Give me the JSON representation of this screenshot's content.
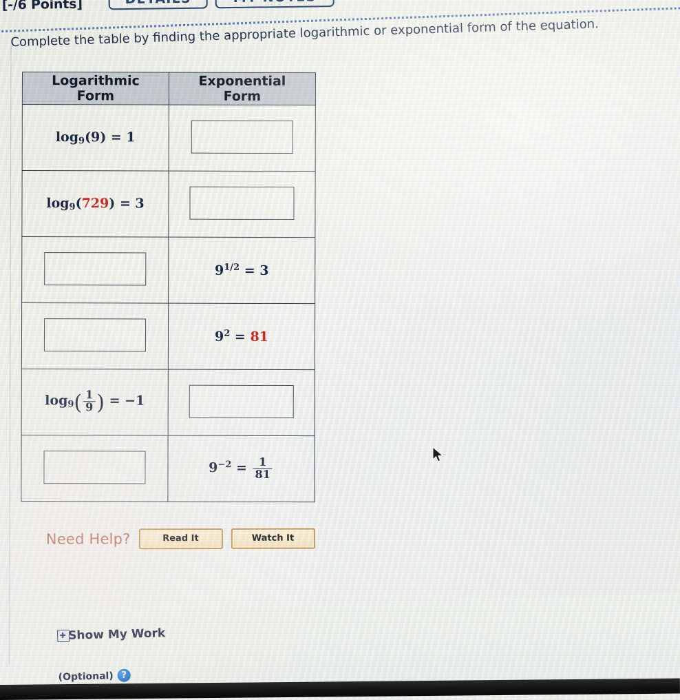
{
  "header": {
    "points": "[-/6 Points]",
    "details_button": "DETAILS",
    "notes_button": "MY NOTES"
  },
  "instruction": "Complete the table by finding the appropriate logarithmic or exponential form of the equation.",
  "table": {
    "columns": [
      "Logarithmic Form",
      "Exponential Form"
    ],
    "rows": [
      {
        "log_form": {
          "type": "math",
          "base": "9",
          "arg": "9",
          "rhs": "1",
          "text": "log_9(9) = 1"
        },
        "exp_form": {
          "type": "input",
          "value": "",
          "placeholder": ""
        }
      },
      {
        "log_form": {
          "type": "math",
          "base": "9",
          "arg": "729",
          "arg_highlighted": true,
          "rhs": "3",
          "text": "log_9(729) = 3"
        },
        "exp_form": {
          "type": "input",
          "value": "",
          "placeholder": ""
        }
      },
      {
        "log_form": {
          "type": "input",
          "value": "",
          "placeholder": ""
        },
        "exp_form": {
          "type": "math",
          "base": "9",
          "exponent": "1/2",
          "rhs": "3",
          "text": "9^(1/2) = 3"
        }
      },
      {
        "log_form": {
          "type": "input",
          "value": "",
          "placeholder": ""
        },
        "exp_form": {
          "type": "math",
          "base": "9",
          "exponent": "2",
          "rhs": "81",
          "rhs_highlighted": true,
          "text": "9^2 = 81"
        }
      },
      {
        "log_form": {
          "type": "math",
          "base": "9",
          "arg_num": "1",
          "arg_den": "9",
          "rhs": "-1",
          "text": "log_9(1/9) = -1"
        },
        "exp_form": {
          "type": "input",
          "value": "",
          "placeholder": ""
        }
      },
      {
        "log_form": {
          "type": "input",
          "value": "",
          "placeholder": ""
        },
        "exp_form": {
          "type": "math",
          "base": "9",
          "exponent": "-2",
          "rhs_num": "1",
          "rhs_den": "81",
          "text": "9^(-2) = 1/81"
        }
      }
    ]
  },
  "need_help": {
    "label": "Need Help?",
    "read_button": "Read It",
    "watch_button": "Watch It"
  },
  "show_my_work": {
    "title": "Show My Work",
    "optional_label": "(Optional)",
    "help_icon_glyph": "?"
  },
  "colors": {
    "highlight_red": "#cc2a23",
    "math_navy": "#1b2a47",
    "link_blue": "#2a4875",
    "need_help_text": "#b5705c",
    "help_button_border": "#c89a54",
    "header_cell_bg": "#c4c9d1"
  }
}
